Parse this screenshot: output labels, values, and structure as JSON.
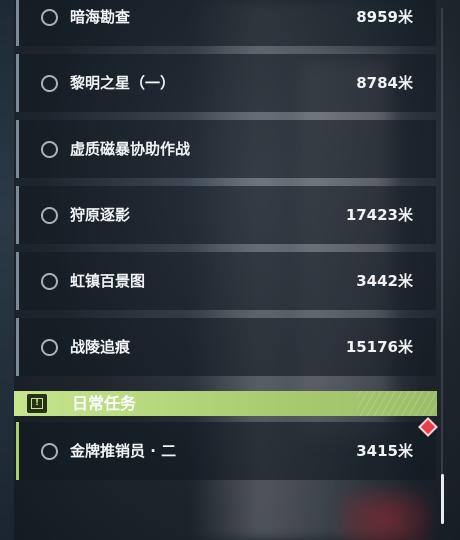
{
  "missions": [
    {
      "name": "暗海勘查",
      "distance": "8959米"
    },
    {
      "name": "黎明之星（一）",
      "distance": "8784米"
    },
    {
      "name": "虚质磁暴协助作战",
      "distance": ""
    },
    {
      "name": "狩原逐影",
      "distance": "17423米"
    },
    {
      "name": "虹镇百景图",
      "distance": "3442米"
    },
    {
      "name": "战陵追痕",
      "distance": "15176米"
    }
  ],
  "daily_section": {
    "title": "日常任务",
    "icon": "exclamation-icon"
  },
  "daily_missions": [
    {
      "name": "金牌推销员 · 二",
      "distance": "3415米"
    }
  ],
  "colors": {
    "daily_accent": "#a7cf6b",
    "badge": "#e4414c",
    "item_border": "#7b8c98"
  }
}
